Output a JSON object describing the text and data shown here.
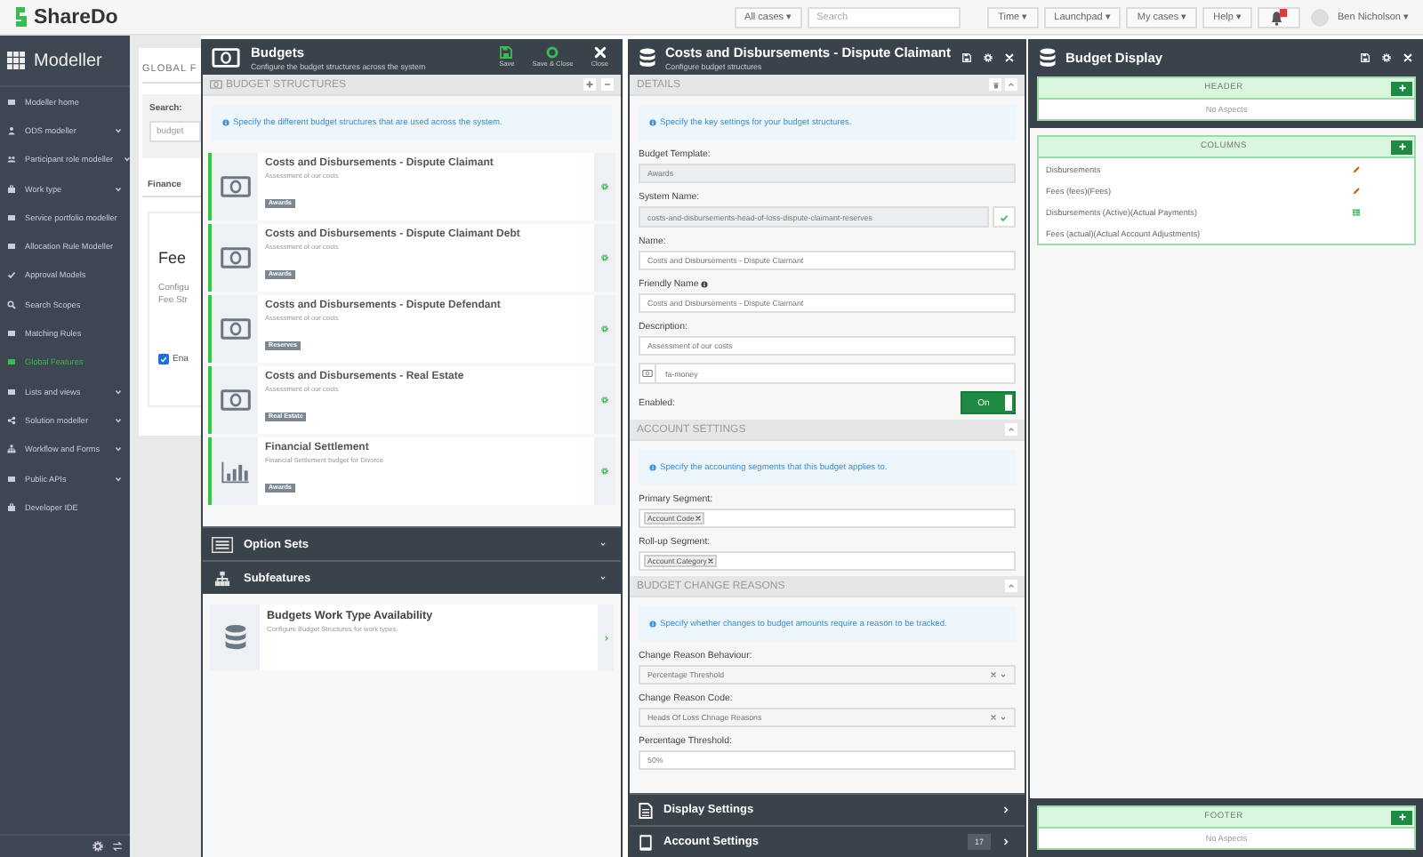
{
  "topbar": {
    "logo": "ShareDo",
    "scope": "All cases ▾",
    "search": {
      "placeholder": "Search"
    },
    "menus": [
      "Time ▾",
      "Launchpad ▾",
      "My cases ▾",
      "Help ▾"
    ],
    "user": "Ben Nicholson ▾"
  },
  "sidebar": {
    "title": "Modeller",
    "items": [
      {
        "label": "Modeller home",
        "expandable": false,
        "selected": false
      },
      {
        "label": "ODS modeller",
        "expandable": true,
        "selected": false
      },
      {
        "label": "Participant role modeller",
        "expandable": true,
        "selected": false
      },
      {
        "label": "Work type",
        "expandable": true,
        "selected": false
      },
      {
        "label": "Service portfolio modeller",
        "expandable": false,
        "selected": false
      },
      {
        "label": "Allocation Rule Modeller",
        "expandable": false,
        "selected": false
      },
      {
        "label": "Approval Models",
        "expandable": false,
        "selected": false
      },
      {
        "label": "Search Scopes",
        "expandable": false,
        "selected": false
      },
      {
        "label": "Matching Rules",
        "expandable": false,
        "selected": false
      },
      {
        "label": "Global Features",
        "expandable": false,
        "selected": true
      },
      {
        "label": "Lists and views",
        "expandable": true,
        "selected": false
      },
      {
        "label": "Solution modeller",
        "expandable": true,
        "selected": false
      },
      {
        "label": "Workflow and Forms",
        "expandable": true,
        "selected": false
      },
      {
        "label": "Public APIs",
        "expandable": true,
        "selected": false
      },
      {
        "label": "Developer IDE",
        "expandable": false,
        "selected": false
      }
    ]
  },
  "background": {
    "heading": "GLOBAL F",
    "search_label": "Search:",
    "search_value": "budget",
    "tab": "Finance",
    "card_title": "Fee",
    "card_text": [
      "Configu",
      "Fee Str"
    ],
    "checkbox": {
      "label": "Ena",
      "checked": true
    }
  },
  "budgets": {
    "title": "Budgets",
    "subtitle": "Configure the budget structures across the system",
    "actions": [
      "Save",
      "Save & Close",
      "Close"
    ],
    "section": "BUDGET STRUCTURES",
    "info": "Specify the different budget structures that are used across the system.",
    "structures": [
      {
        "kind": "money",
        "title": "Costs and Disbursements - Dispute Claimant",
        "description": "Assessment of our costs",
        "tag": "Awards"
      },
      {
        "kind": "money",
        "title": "Costs and Disbursements - Dispute Claimant Debt",
        "description": "Assessment of our costs",
        "tag": "Awards"
      },
      {
        "kind": "money",
        "title": "Costs and Disbursements - Dispute Defendant",
        "description": "Assessment of our costs",
        "tag": "Reserves"
      },
      {
        "kind": "money",
        "title": "Costs and Disbursements - Real Estate",
        "description": "Assessment of our costs",
        "tag": "Real Estate"
      },
      {
        "kind": "chart",
        "title": "Financial Settlement",
        "description": "Financial Settlement budget for Divorce",
        "tag": "Awards"
      }
    ],
    "groups": [
      "Option Sets",
      "Subfeatures"
    ],
    "subfeatures": [
      {
        "title": "Budgets Work Type Availability",
        "description": "Configure Budget Structures for work types."
      }
    ]
  },
  "details": {
    "title": "Costs and Disbursements - Dispute Claimant",
    "subtitle": "Configure budget structures",
    "sections": [
      {
        "title": "DETAILS",
        "delete_button": true,
        "info": "Specify the key settings for your budget structures.",
        "fields": [
          {
            "kind": "readonly",
            "label": "Budget Template:",
            "value": "Awards"
          },
          {
            "kind": "validated",
            "label": "System Name:",
            "value": "costs-and-disbursements-head-of-loss-dispute-claimant-reserves"
          },
          {
            "kind": "text",
            "label": "Name:",
            "value": "Costs and Disbursements - Dispute Claimant"
          },
          {
            "kind": "text-help",
            "label": "Friendly Name",
            "value": "Costs and Disbursements - Dispute Claimant"
          },
          {
            "kind": "text",
            "label": "Description:",
            "value": "Assessment of our costs"
          },
          {
            "kind": "icon",
            "value": "fa-money"
          },
          {
            "kind": "toggle",
            "label": "Enabled:",
            "value": "On",
            "on": true
          }
        ]
      },
      {
        "title": "ACCOUNT SETTINGS",
        "delete_button": false,
        "info": "Specify the accounting segments that this budget applies to.",
        "fields": [
          {
            "kind": "tags",
            "label": "Primary Segment:",
            "tags": [
              "Account Code"
            ]
          },
          {
            "kind": "tags",
            "label": "Roll-up Segment:",
            "tags": [
              "Account Category"
            ]
          }
        ]
      },
      {
        "title": "BUDGET CHANGE REASONS",
        "delete_button": false,
        "info": "Specify whether changes to budget amounts require a reason to be tracked.",
        "fields": [
          {
            "kind": "select",
            "label": "Change Reason Behaviour:",
            "value": "Percentage Threshold"
          },
          {
            "kind": "select",
            "label": "Change Reason Code:",
            "value": "Heads Of Loss Chnage Reasons"
          },
          {
            "kind": "text",
            "label": "Percentage Threshold:",
            "value": "50%"
          }
        ]
      }
    ],
    "groups": [
      {
        "kind": "document",
        "label": "Display Settings"
      },
      {
        "kind": "tablet",
        "label": "Account Settings",
        "count": "17"
      }
    ]
  },
  "display": {
    "title": "Budget Display",
    "zones": [
      {
        "title": "HEADER",
        "empty": "No Aspects"
      },
      {
        "title": "COLUMNS",
        "rows": [
          {
            "label": "Disbursements",
            "kind": "edit"
          },
          {
            "label": "Fees (fees)(Fees)",
            "kind": "edit"
          },
          {
            "label": "Disbursements (Active)(Actual Payments)",
            "kind": "table"
          },
          {
            "label": "Fees (actual)(Actual Account Adjustments)",
            "kind": "plain"
          }
        ]
      },
      {
        "title": "FOOTER",
        "empty": "No Aspects"
      }
    ]
  }
}
